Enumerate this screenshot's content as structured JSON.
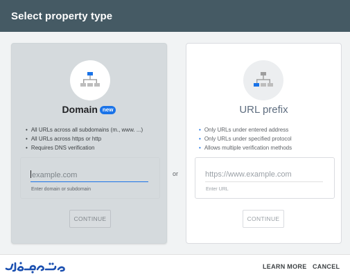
{
  "dialog": {
    "title": "Select property type"
  },
  "domain_card": {
    "icon": "domain-tree-icon",
    "title": "Domain",
    "badge": "new",
    "bullets": [
      "All URLs across all subdomains (m., www. ...)",
      "All URLs across https or http",
      "Requires DNS verification"
    ],
    "input_placeholder": "example.com",
    "helper": "Enter domain or subdomain",
    "continue_label": "CONTINUE"
  },
  "separator": "or",
  "url_card": {
    "icon": "url-prefix-tree-icon",
    "title": "URL prefix",
    "bullets": [
      "Only URLs under entered address",
      "Only URLs under specified protocol",
      "Allows multiple verification methods"
    ],
    "input_placeholder": "https://www.example.com",
    "helper": "Enter URL",
    "continue_label": "CONTINUE"
  },
  "footer": {
    "logo": "arabic-watermark-logo",
    "learn_more": "LEARN MORE",
    "cancel": "CANCEL"
  },
  "colors": {
    "header": "#455a64",
    "accent": "#1a73e8",
    "selected_card": "#d5dadd"
  }
}
